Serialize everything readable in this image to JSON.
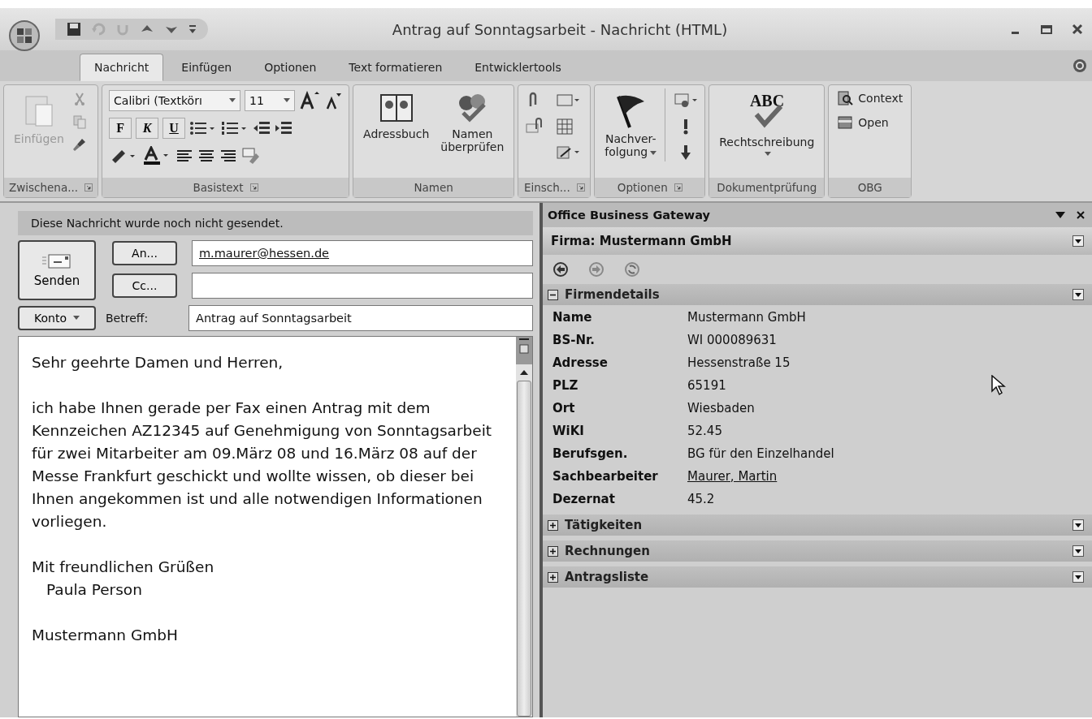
{
  "window": {
    "title": "Antrag auf Sonntagsarbeit - Nachricht (HTML)"
  },
  "tabs": [
    {
      "label": "Nachricht",
      "selected": true
    },
    {
      "label": "Einfügen",
      "selected": false
    },
    {
      "label": "Optionen",
      "selected": false
    },
    {
      "label": "Text formatieren",
      "selected": false
    },
    {
      "label": "Entwicklertools",
      "selected": false
    }
  ],
  "ribbon": {
    "groups": [
      {
        "kind": "clipboard",
        "label": "Zwischena...",
        "paste": {
          "label": "Einfügen",
          "disabled": true
        }
      },
      {
        "kind": "font",
        "label": "Basistext",
        "font": "Calibri (Textkörı",
        "size": "11",
        "bold": "F",
        "italic": "K",
        "underline": "U"
      },
      {
        "kind": "names",
        "label": "Namen",
        "buttons": [
          "Adressbuch",
          "Namen\nüberprüfen"
        ]
      },
      {
        "kind": "include",
        "label": "Einsch..."
      },
      {
        "kind": "options",
        "label": "Optionen",
        "button": "Nachver-\nfolgung"
      },
      {
        "kind": "proofing",
        "label": "Dokumentprüfung",
        "button": "Rechtschreibung",
        "icon_text": "ABC"
      },
      {
        "kind": "obg",
        "label": "OBG",
        "buttons": [
          "Context",
          "Open"
        ]
      }
    ]
  },
  "compose": {
    "notice": "Diese Nachricht wurde noch nicht gesendet.",
    "send": "Senden",
    "to": {
      "button": "An...",
      "value": "m.maurer@hessen.de"
    },
    "cc": {
      "button": "Cc..."
    },
    "account": "Konto",
    "subject_label": "Betreff:",
    "subject": "Antrag auf Sonntagsarbeit",
    "body": [
      {
        "kind": "para",
        "text": "Sehr geehrte Damen und Herren,"
      },
      {
        "kind": "para",
        "text": "ich habe Ihnen gerade per Fax einen Antrag mit dem Kennzeichen AZ12345 auf Genehmigung von Sonntagsarbeit für zwei Mitarbeiter am 09.März 08 und 16.März 08 auf der Messe Frankfurt geschickt und wollte wissen, ob dieser bei Ihnen angekommen ist und alle notwendigen Informationen vorliegen."
      },
      {
        "kind": "closing",
        "text": "Mit freundlichen Grüßen",
        "signature": "Paula Person"
      },
      {
        "kind": "para",
        "text": "Mustermann GmbH"
      }
    ]
  },
  "pane": {
    "title": "Office Business Gateway",
    "company": "Firma: Mustermann GmbH",
    "sections": [
      {
        "label": "Firmendetails",
        "expanded": true,
        "fields": [
          {
            "label": "Name",
            "value": "Mustermann GmbH"
          },
          {
            "label": "BS-Nr.",
            "value": "WI 000089631"
          },
          {
            "label": "Adresse",
            "value": "Hessenstraße 15"
          },
          {
            "label": "PLZ",
            "value": "65191"
          },
          {
            "label": "Ort",
            "value": "Wiesbaden"
          },
          {
            "label": "WiKI",
            "value": "52.45"
          },
          {
            "label": "Berufsgen.",
            "value": "BG für den Einzelhandel"
          },
          {
            "label": "Sachbearbeiter",
            "value": "Maurer, Martin",
            "kind": "link"
          },
          {
            "label": "Dezernat",
            "value": "45.2"
          }
        ]
      },
      {
        "label": "Tätigkeiten",
        "expanded": false
      },
      {
        "label": "Rechnungen",
        "expanded": false
      },
      {
        "label": "Antragsliste",
        "expanded": false
      }
    ]
  }
}
